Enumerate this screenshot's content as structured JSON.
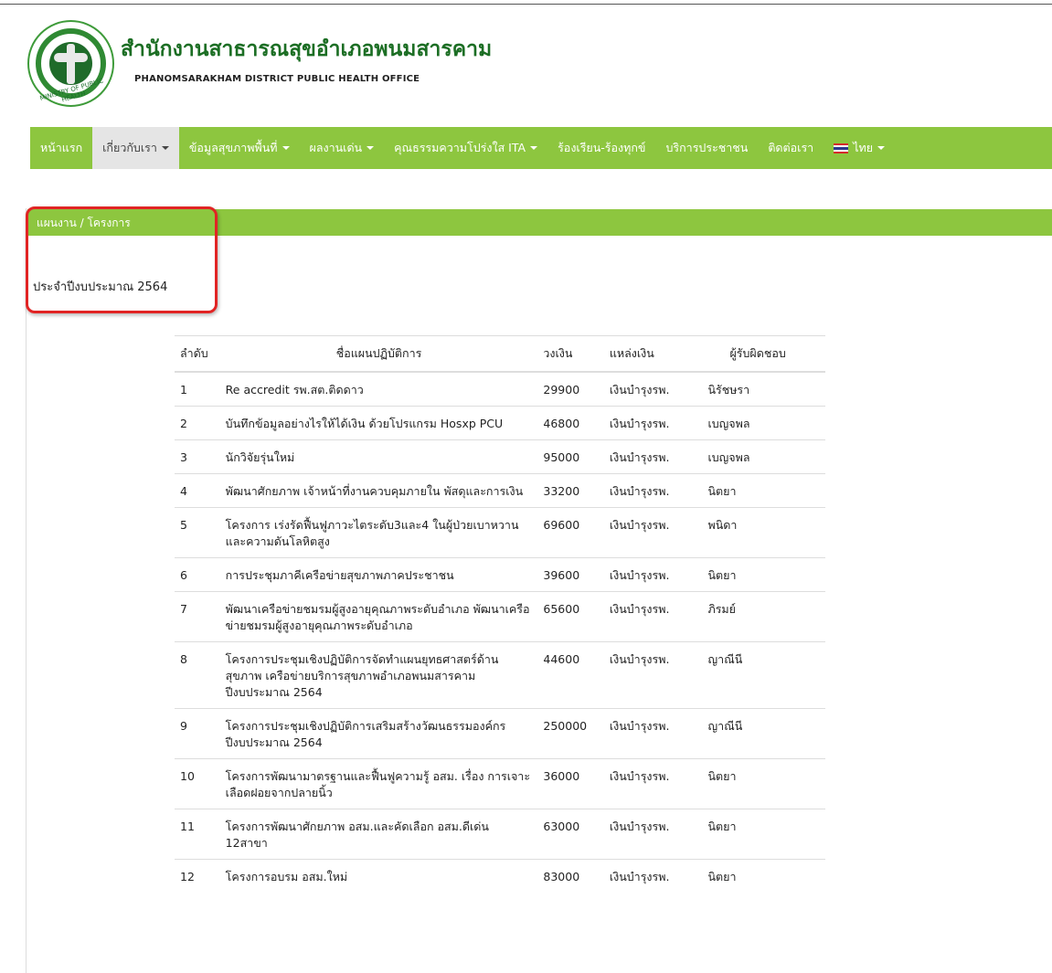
{
  "header": {
    "title_th": "สำนักงานสาธารณสุขอำเภอพนมสารคาม",
    "title_en": "PHANOMSARAKHAM DISTRICT PUBLIC HEALTH OFFICE",
    "logo_text": "MINISTRY OF PUBLIC HEALTH"
  },
  "nav": {
    "items": [
      {
        "label": "หน้าแรก",
        "dropdown": false
      },
      {
        "label": "เกี่ยวกับเรา",
        "dropdown": true,
        "active": true
      },
      {
        "label": "ข้อมูลสุขภาพพื้นที่",
        "dropdown": true
      },
      {
        "label": "ผลงานเด่น",
        "dropdown": true
      },
      {
        "label": "คุณธรรมความโปร่งใส ITA",
        "dropdown": true
      },
      {
        "label": "ร้องเรียน-ร้องทุกข์",
        "dropdown": false
      },
      {
        "label": "บริการประชาชน",
        "dropdown": false
      },
      {
        "label": "ติดต่อเรา",
        "dropdown": false
      },
      {
        "label": "ไทย",
        "dropdown": true
      }
    ],
    "active_color": "#e5e5e5",
    "bar_color": "#8dc63f"
  },
  "section": {
    "title": "แผนงาน / โครงการ",
    "budget_year": "ประจำปีงบประมาณ 2564",
    "highlight_color": "#e12424"
  },
  "table": {
    "headers": [
      "ลำดับ",
      "ชื่อแผนปฏิบัติการ",
      "วงเงิน",
      "แหล่งเงิน",
      "ผู้รับผิดชอบ"
    ],
    "rows": [
      {
        "no": "1",
        "name": "Re accredit รพ.สต.ติดดาว",
        "amount": "29900",
        "source": "เงินบำรุงรพ.",
        "owner": "นิรัชษรา"
      },
      {
        "no": "2",
        "name": "บันทึกข้อมูลอย่างไรให้ได้เงิน ด้วยโปรแกรม Hosxp PCU",
        "amount": "46800",
        "source": "เงินบำรุงรพ.",
        "owner": "เบญจพล"
      },
      {
        "no": "3",
        "name": "นักวิจัยรุ่นใหม่",
        "amount": "95000",
        "source": "เงินบำรุงรพ.",
        "owner": "เบญจพล"
      },
      {
        "no": "4",
        "name": "พัฒนาศักยภาพ เจ้าหน้าที่งานควบคุมภายใน พัสดุและการเงิน",
        "amount": "33200",
        "source": "เงินบำรุงรพ.",
        "owner": "นิตยา"
      },
      {
        "no": "5",
        "name": "โครงการ เร่งรัดฟื้นฟูภาวะไตระดับ3และ4 ในผู้ป่วยเบาหวานและความดันโลหิตสูง",
        "amount": "69600",
        "source": "เงินบำรุงรพ.",
        "owner": "พนิดา"
      },
      {
        "no": "6",
        "name": "การประชุมภาคีเครือข่ายสุขภาพภาคประชาชน",
        "amount": "39600",
        "source": "เงินบำรุงรพ.",
        "owner": "นิตยา"
      },
      {
        "no": "7",
        "name": "พัฒนาเครือข่ายชมรมผู้สูงอายุคุณภาพระดับอำเภอ พัฒนาเครือข่ายชมรมผู้สูงอายุคุณภาพระดับอำเภอ",
        "amount": "65600",
        "source": "เงินบำรุงรพ.",
        "owner": "ภิรมย์"
      },
      {
        "no": "8",
        "name": "โครงการประชุมเชิงปฏิบัติการจัดทำแผนยุทธศาสตร์ด้านสุขภาพ เครือข่ายบริการสุขภาพอำเภอพนมสารคาม ปีงบประมาณ 2564",
        "amount": "44600",
        "source": "เงินบำรุงรพ.",
        "owner": "ญาณีนี"
      },
      {
        "no": "9",
        "name": "โครงการประชุมเชิงปฏิบัติการเสริมสร้างวัฒนธรรมองค์กร ปีงบประมาณ 2564",
        "amount": "250000",
        "source": "เงินบำรุงรพ.",
        "owner": "ญาณีนี"
      },
      {
        "no": "10",
        "name": "โครงการพัฒนามาตรฐานและฟื้นฟูความรู้ อสม. เรื่อง การเจาะเลือดฝอยจากปลายนิ้ว",
        "amount": "36000",
        "source": "เงินบำรุงรพ.",
        "owner": "นิตยา"
      },
      {
        "no": "11",
        "name": "โครงการพัฒนาศักยภาพ อสม.และคัดเลือก อสม.ดีเด่น 12สาขา",
        "amount": "63000",
        "source": "เงินบำรุงรพ.",
        "owner": "นิตยา"
      },
      {
        "no": "12",
        "name": "โครงการอบรม อสม.ใหม่",
        "amount": "83000",
        "source": "เงินบำรุงรพ.",
        "owner": "นิตยา"
      }
    ]
  }
}
